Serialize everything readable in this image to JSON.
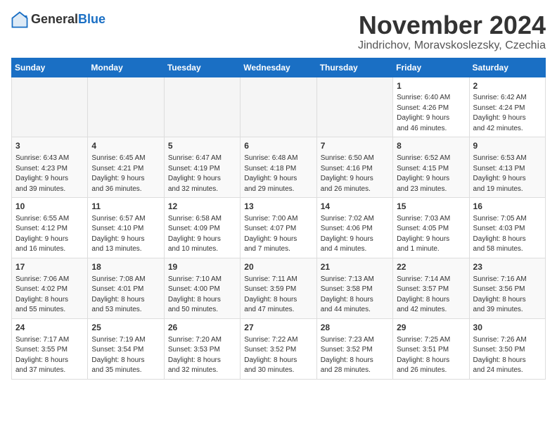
{
  "logo": {
    "general": "General",
    "blue": "Blue"
  },
  "title": "November 2024",
  "location": "Jindrichov, Moravskoslezsky, Czechia",
  "days_header": [
    "Sunday",
    "Monday",
    "Tuesday",
    "Wednesday",
    "Thursday",
    "Friday",
    "Saturday"
  ],
  "weeks": [
    [
      {
        "day": "",
        "info": ""
      },
      {
        "day": "",
        "info": ""
      },
      {
        "day": "",
        "info": ""
      },
      {
        "day": "",
        "info": ""
      },
      {
        "day": "",
        "info": ""
      },
      {
        "day": "1",
        "info": "Sunrise: 6:40 AM\nSunset: 4:26 PM\nDaylight: 9 hours\nand 46 minutes."
      },
      {
        "day": "2",
        "info": "Sunrise: 6:42 AM\nSunset: 4:24 PM\nDaylight: 9 hours\nand 42 minutes."
      }
    ],
    [
      {
        "day": "3",
        "info": "Sunrise: 6:43 AM\nSunset: 4:23 PM\nDaylight: 9 hours\nand 39 minutes."
      },
      {
        "day": "4",
        "info": "Sunrise: 6:45 AM\nSunset: 4:21 PM\nDaylight: 9 hours\nand 36 minutes."
      },
      {
        "day": "5",
        "info": "Sunrise: 6:47 AM\nSunset: 4:19 PM\nDaylight: 9 hours\nand 32 minutes."
      },
      {
        "day": "6",
        "info": "Sunrise: 6:48 AM\nSunset: 4:18 PM\nDaylight: 9 hours\nand 29 minutes."
      },
      {
        "day": "7",
        "info": "Sunrise: 6:50 AM\nSunset: 4:16 PM\nDaylight: 9 hours\nand 26 minutes."
      },
      {
        "day": "8",
        "info": "Sunrise: 6:52 AM\nSunset: 4:15 PM\nDaylight: 9 hours\nand 23 minutes."
      },
      {
        "day": "9",
        "info": "Sunrise: 6:53 AM\nSunset: 4:13 PM\nDaylight: 9 hours\nand 19 minutes."
      }
    ],
    [
      {
        "day": "10",
        "info": "Sunrise: 6:55 AM\nSunset: 4:12 PM\nDaylight: 9 hours\nand 16 minutes."
      },
      {
        "day": "11",
        "info": "Sunrise: 6:57 AM\nSunset: 4:10 PM\nDaylight: 9 hours\nand 13 minutes."
      },
      {
        "day": "12",
        "info": "Sunrise: 6:58 AM\nSunset: 4:09 PM\nDaylight: 9 hours\nand 10 minutes."
      },
      {
        "day": "13",
        "info": "Sunrise: 7:00 AM\nSunset: 4:07 PM\nDaylight: 9 hours\nand 7 minutes."
      },
      {
        "day": "14",
        "info": "Sunrise: 7:02 AM\nSunset: 4:06 PM\nDaylight: 9 hours\nand 4 minutes."
      },
      {
        "day": "15",
        "info": "Sunrise: 7:03 AM\nSunset: 4:05 PM\nDaylight: 9 hours\nand 1 minute."
      },
      {
        "day": "16",
        "info": "Sunrise: 7:05 AM\nSunset: 4:03 PM\nDaylight: 8 hours\nand 58 minutes."
      }
    ],
    [
      {
        "day": "17",
        "info": "Sunrise: 7:06 AM\nSunset: 4:02 PM\nDaylight: 8 hours\nand 55 minutes."
      },
      {
        "day": "18",
        "info": "Sunrise: 7:08 AM\nSunset: 4:01 PM\nDaylight: 8 hours\nand 53 minutes."
      },
      {
        "day": "19",
        "info": "Sunrise: 7:10 AM\nSunset: 4:00 PM\nDaylight: 8 hours\nand 50 minutes."
      },
      {
        "day": "20",
        "info": "Sunrise: 7:11 AM\nSunset: 3:59 PM\nDaylight: 8 hours\nand 47 minutes."
      },
      {
        "day": "21",
        "info": "Sunrise: 7:13 AM\nSunset: 3:58 PM\nDaylight: 8 hours\nand 44 minutes."
      },
      {
        "day": "22",
        "info": "Sunrise: 7:14 AM\nSunset: 3:57 PM\nDaylight: 8 hours\nand 42 minutes."
      },
      {
        "day": "23",
        "info": "Sunrise: 7:16 AM\nSunset: 3:56 PM\nDaylight: 8 hours\nand 39 minutes."
      }
    ],
    [
      {
        "day": "24",
        "info": "Sunrise: 7:17 AM\nSunset: 3:55 PM\nDaylight: 8 hours\nand 37 minutes."
      },
      {
        "day": "25",
        "info": "Sunrise: 7:19 AM\nSunset: 3:54 PM\nDaylight: 8 hours\nand 35 minutes."
      },
      {
        "day": "26",
        "info": "Sunrise: 7:20 AM\nSunset: 3:53 PM\nDaylight: 8 hours\nand 32 minutes."
      },
      {
        "day": "27",
        "info": "Sunrise: 7:22 AM\nSunset: 3:52 PM\nDaylight: 8 hours\nand 30 minutes."
      },
      {
        "day": "28",
        "info": "Sunrise: 7:23 AM\nSunset: 3:52 PM\nDaylight: 8 hours\nand 28 minutes."
      },
      {
        "day": "29",
        "info": "Sunrise: 7:25 AM\nSunset: 3:51 PM\nDaylight: 8 hours\nand 26 minutes."
      },
      {
        "day": "30",
        "info": "Sunrise: 7:26 AM\nSunset: 3:50 PM\nDaylight: 8 hours\nand 24 minutes."
      }
    ]
  ]
}
